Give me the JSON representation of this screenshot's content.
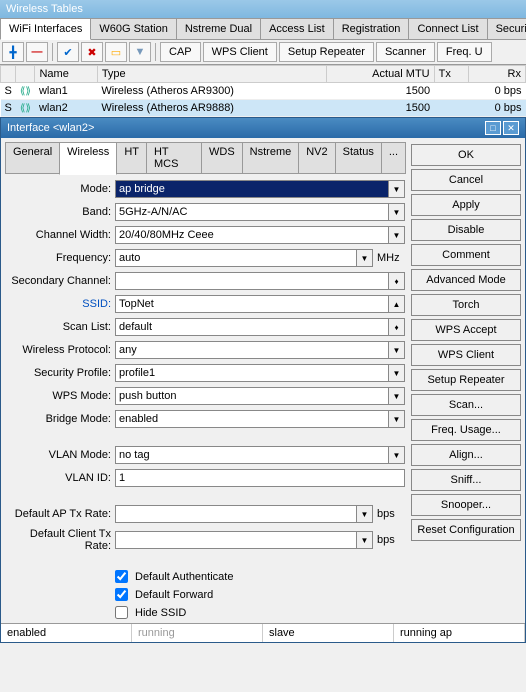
{
  "main_title": "Wireless Tables",
  "main_tabs": [
    "WiFi Interfaces",
    "W60G Station",
    "Nstreme Dual",
    "Access List",
    "Registration",
    "Connect List",
    "Security Profiles"
  ],
  "toolbar": {
    "cap": "CAP",
    "wps_client": "WPS Client",
    "setup_repeater": "Setup Repeater",
    "scanner": "Scanner",
    "freq": "Freq. U"
  },
  "table": {
    "headers": [
      "",
      "",
      "Name",
      "Type",
      "Actual MTU",
      "Tx",
      "Rx"
    ],
    "rows": [
      {
        "s": "S",
        "name": "wlan1",
        "type": "Wireless (Atheros AR9300)",
        "mtu": "1500",
        "tx": "",
        "rx": "0 bps"
      },
      {
        "s": "S",
        "name": "wlan2",
        "type": "Wireless (Atheros AR9888)",
        "mtu": "1500",
        "tx": "",
        "rx": "0 bps"
      }
    ]
  },
  "dialog": {
    "title": "Interface <wlan2>",
    "tabs": [
      "General",
      "Wireless",
      "HT",
      "HT MCS",
      "WDS",
      "Nstreme",
      "NV2",
      "Status",
      "..."
    ],
    "side_buttons": [
      "OK",
      "Cancel",
      "Apply",
      "Disable",
      "Comment",
      "Advanced Mode",
      "Torch",
      "WPS Accept",
      "WPS Client",
      "Setup Repeater",
      "Scan...",
      "Freq. Usage...",
      "Align...",
      "Sniff...",
      "Snooper...",
      "Reset Configuration"
    ],
    "fields": {
      "mode": {
        "label": "Mode:",
        "value": "ap bridge"
      },
      "band": {
        "label": "Band:",
        "value": "5GHz-A/N/AC"
      },
      "channel_width": {
        "label": "Channel Width:",
        "value": "20/40/80MHz Ceee"
      },
      "frequency": {
        "label": "Frequency:",
        "value": "auto",
        "unit": "MHz"
      },
      "secondary_channel": {
        "label": "Secondary Channel:",
        "value": ""
      },
      "ssid": {
        "label": "SSID:",
        "value": "TopNet"
      },
      "scan_list": {
        "label": "Scan List:",
        "value": "default"
      },
      "wireless_protocol": {
        "label": "Wireless Protocol:",
        "value": "any"
      },
      "security_profile": {
        "label": "Security Profile:",
        "value": "profile1"
      },
      "wps_mode": {
        "label": "WPS Mode:",
        "value": "push button"
      },
      "bridge_mode": {
        "label": "Bridge Mode:",
        "value": "enabled"
      },
      "vlan_mode": {
        "label": "VLAN Mode:",
        "value": "no tag"
      },
      "vlan_id": {
        "label": "VLAN ID:",
        "value": "1"
      },
      "default_ap_tx": {
        "label": "Default AP Tx Rate:",
        "value": "",
        "unit": "bps"
      },
      "default_client_tx": {
        "label": "Default Client Tx Rate:",
        "value": "",
        "unit": "bps"
      },
      "default_auth": "Default Authenticate",
      "default_forward": "Default Forward",
      "hide_ssid": "Hide SSID"
    },
    "status": [
      "enabled",
      "running",
      "slave",
      "running ap"
    ]
  }
}
